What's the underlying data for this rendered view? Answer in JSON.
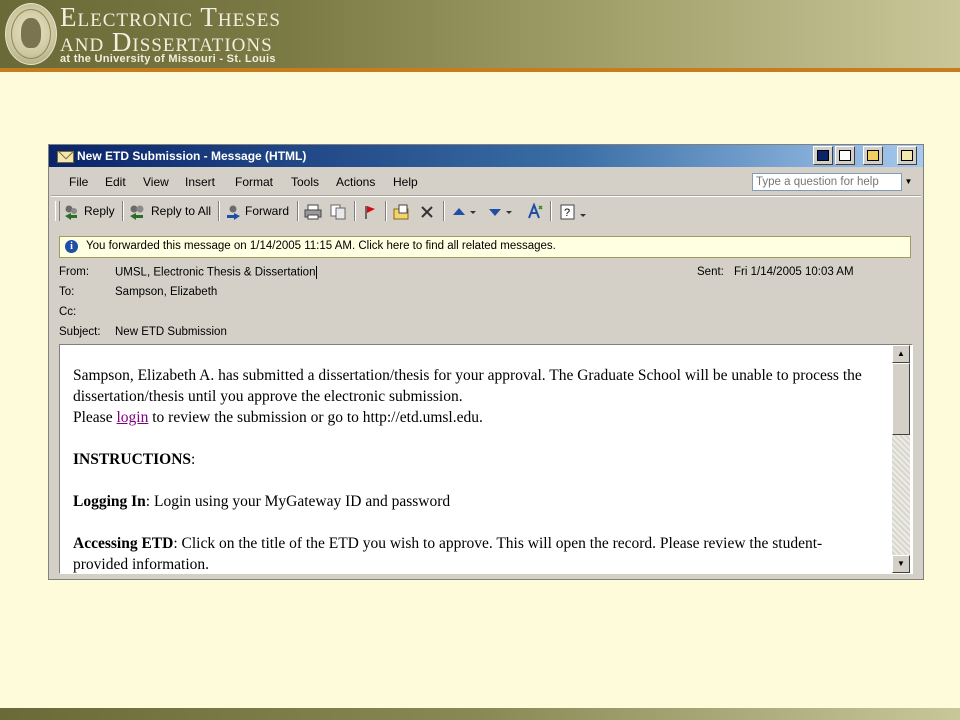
{
  "slide": {
    "title_line1": "Electronic Theses",
    "title_line2": "and Dissertations",
    "title_line3": "at the University of Missouri - St. Louis",
    "colors": {
      "banner": "#7b7a45",
      "accent_line": "#c77c1e",
      "background": "#fdfbd9"
    }
  },
  "window": {
    "title": "New ETD Submission - Message (HTML)"
  },
  "menu": [
    "File",
    "Edit",
    "View",
    "Insert",
    "Format",
    "Tools",
    "Actions",
    "Help"
  ],
  "search": {
    "placeholder": "Type a question for help"
  },
  "toolbar": {
    "reply": "Reply",
    "reply_all": "Reply to All",
    "forward": "Forward",
    "icons": [
      "print-icon",
      "copy-icon",
      "flag-icon",
      "move-to-folder-icon",
      "delete-icon",
      "previous-item-icon",
      "next-item-icon",
      "address-book-icon",
      "help-icon"
    ]
  },
  "infobar": {
    "text": "You forwarded this message on 1/14/2005 11:15 AM. Click here to find all related messages."
  },
  "header": {
    "from_label": "From:",
    "from_value": "UMSL, Electronic Thesis & Dissertation",
    "sent_label": "Sent:",
    "sent_value": "Fri 1/14/2005 10:03 AM",
    "to_label": "To:",
    "to_value": "Sampson, Elizabeth",
    "cc_label": "Cc:",
    "cc_value": "",
    "subject_label": "Subject:",
    "subject_value": "New ETD Submission"
  },
  "message": {
    "para1": "Sampson, Elizabeth A. has submitted a dissertation/thesis for your approval. The Graduate School will be unable to process the dissertation/thesis until you approve the electronic submission.",
    "para2_prefix": "Please ",
    "para2_link": "login",
    "para2_suffix": " to review the submission or go to http://etd.umsl.edu.",
    "instructions_heading": "INSTRUCTIONS",
    "instructions_colon": ":",
    "logging_in_label": "Logging In",
    "logging_in_text": ": Login using your MyGateway ID and password",
    "accessing_label": "Accessing ETD",
    "accessing_text": ": Click on the title of the ETD you wish to approve. This will open the record. Please review the student-provided information."
  }
}
